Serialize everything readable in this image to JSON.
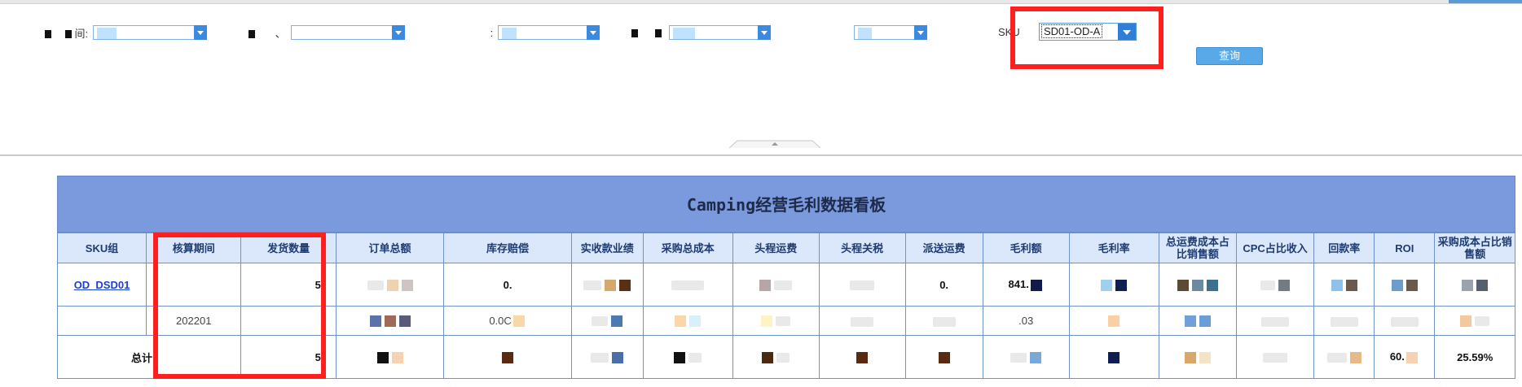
{
  "skuFilter": {
    "label": "SKU",
    "value": "SD01-OD-A"
  },
  "queryButton": "查询",
  "board": {
    "title": "Camping经营毛利数据看板",
    "columns": [
      "SKU组",
      "核算期间",
      "发货数量",
      "订单总额",
      "库存赔偿",
      "实收款业绩",
      "采购总成本",
      "头程运费",
      "头程关税",
      "派送运费",
      "毛利额",
      "毛利率",
      "总运费成本占比销售额",
      "CPC占比收入",
      "回款率",
      "ROI",
      "采购成本占比销售额"
    ],
    "rows": [
      {
        "sku_group": "OD_DSD01",
        "period": "",
        "qty": "5",
        "inventory_comp": "0.",
        "delivery_fee": "0.",
        "gross_profit": "841."
      },
      {
        "sku_group": "",
        "period": "202201",
        "qty": "",
        "inventory_comp": "0.0C",
        "gross_profit": ".03"
      },
      {
        "sku_group": "总计",
        "period": "",
        "qty": "5",
        "roi": "60.",
        "purchase_ratio": "25.59%"
      }
    ]
  },
  "colors": {
    "title_bg": "#7b99dd",
    "header_bg": "#dbe8fb",
    "highlight": "#ff1f1f",
    "button": "#59a9e8"
  }
}
